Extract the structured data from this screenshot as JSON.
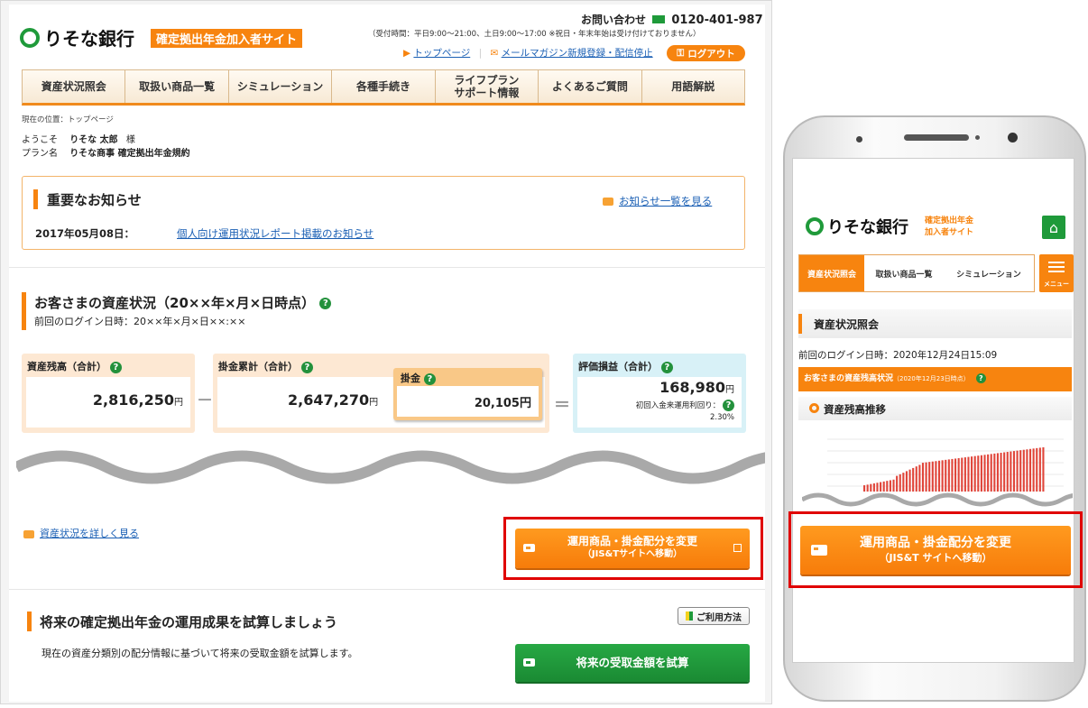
{
  "desktop": {
    "bank_name": "りそな銀行",
    "site_badge": "確定拠出年金加入者サイト",
    "contact_label": "お問い合わせ",
    "contact_phone": "0120-401-987",
    "contact_hours": "（受付時間：平日9:00〜21:00、土日9:00〜17:00 ※祝日・年末年始は受け付けておりません）",
    "top_link": "トップページ",
    "mail_link": "メールマガジン新規登録・配信停止",
    "logout": "ログアウト",
    "nav": [
      {
        "label": "資産状況照会"
      },
      {
        "label": "取扱い商品一覧"
      },
      {
        "label": "シミュレーション"
      },
      {
        "label": "各種手続き"
      },
      {
        "label": "ライフプラン\nサポート情報"
      },
      {
        "label": "よくあるご質問"
      },
      {
        "label": "用語解説"
      }
    ],
    "breadcrumb": "現在の位置：トップページ",
    "welcome_prefix": "ようこそ",
    "user_name": "りそな 太郎",
    "honorific": "様",
    "plan_label": "プラン名",
    "plan_name": "りそな商事 確定拠出年金規約",
    "notice_title": "重要なお知らせ",
    "notice_list_link": "お知らせ一覧を見る",
    "notice_date": "2017年05月08日：",
    "notice_link": "個人向け運用状況レポート掲載のお知らせ",
    "asset_title": "お客さまの資産状況（20××年×月×日時点）",
    "last_login": "前回のログイン日時：20××年×月×日××:××",
    "asset_total_label": "資産残高（合計）",
    "asset_total_value": "2,816,250",
    "contrib_total_label": "掛金累計（合計）",
    "contrib_total_value": "2,647,270",
    "contrib_label": "掛金",
    "contrib_value": "20,105",
    "gain_label": "評価損益（合計）",
    "gain_value": "168,980",
    "yield_label": "初回入金来運用利回り：",
    "yield_value": "2.30%",
    "yen": "円",
    "minus": "－",
    "equals": "＝",
    "qmark": "?",
    "detail_link": "資産状況を詳しく見る",
    "change_button_line1": "運用商品・掛金配分を変更",
    "change_button_line2": "（JIS&Tサイトへ移動）",
    "sim_title": "将来の確定拠出年金の運用成果を試算しましょう",
    "usage_button": "ご利用方法",
    "sim_desc": "現在の資産分類別の配分情報に基づいて将来の受取金額を試算します。",
    "sim_button": "将来の受取金額を試算"
  },
  "mobile": {
    "bank_name": "りそな銀行",
    "site_line1": "確定拠出年金",
    "site_line2": "加入者サイト",
    "tabs": [
      {
        "label": "資産状況照会"
      },
      {
        "label": "取扱い商品一覧"
      },
      {
        "label": "シミュレーション"
      }
    ],
    "menu_label": "メニュー",
    "section_title": "資産状況照会",
    "last_login": "前回のログイン日時：2020年12月24日15:09",
    "status_bar": "お客さまの資産残高状況",
    "status_date": "（2020年12月23日時点）",
    "chart_title": "資産残高推移",
    "button_line1": "運用商品・掛金配分を変更",
    "button_line2": "（JIS&T サイトへ移動）"
  },
  "colors": {
    "brand_green": "#1f9a3a",
    "accent_orange": "#f7840f",
    "highlight_red": "#e00000"
  }
}
